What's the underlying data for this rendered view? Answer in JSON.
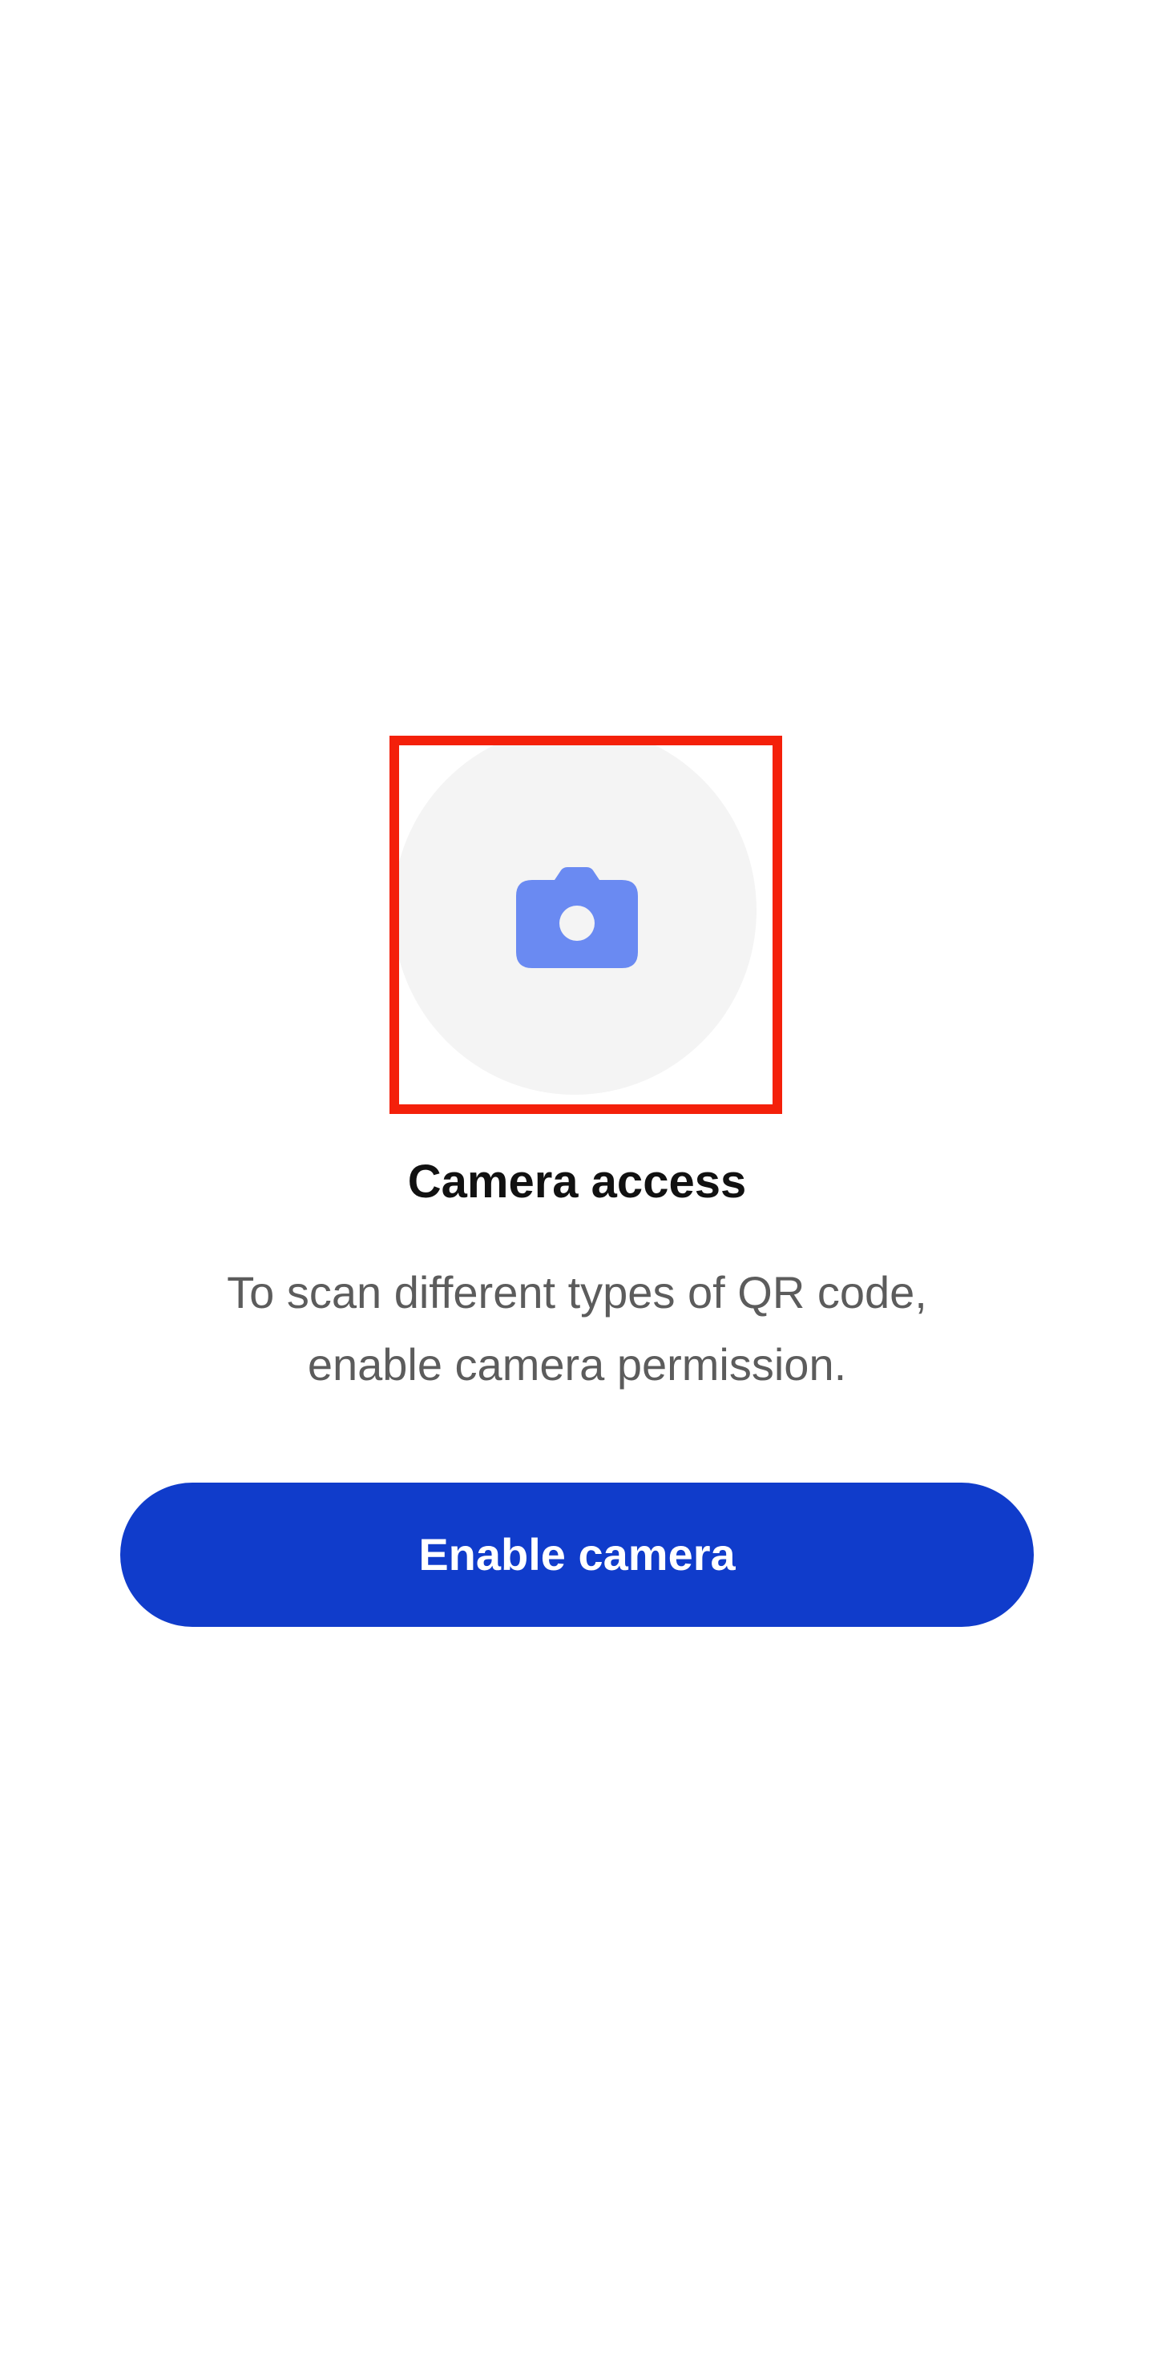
{
  "permission_prompt": {
    "icon": "camera-icon",
    "title": "Camera access",
    "description_line1": "To scan different types of QR code,",
    "description_line2": "enable camera permission.",
    "button_label": "Enable camera"
  },
  "colors": {
    "background": "#ffffff",
    "icon_circle": "#f4f4f4",
    "icon_fill": "#6a8af2",
    "highlight_border": "#f4200a",
    "button_background": "#103ccb",
    "button_text": "#ffffff",
    "title_text": "#111111",
    "description_text": "#5c5c5c"
  }
}
